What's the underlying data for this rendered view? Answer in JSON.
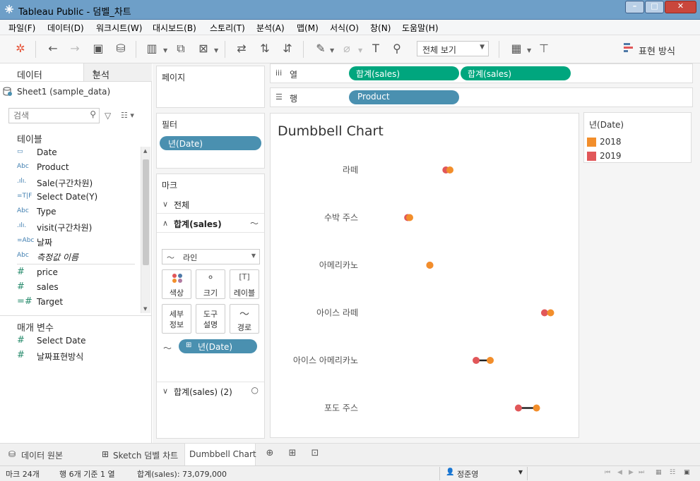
{
  "window": {
    "title": "Tableau Public - 덤벨_차트"
  },
  "menu": [
    "파일(F)",
    "데이터(D)",
    "워크시트(W)",
    "대시보드(B)",
    "스토리(T)",
    "분석(A)",
    "맵(M)",
    "서식(O)",
    "창(N)",
    "도움말(H)"
  ],
  "toolbar": {
    "view_select": "전체 보기",
    "show_me": "표현 방식"
  },
  "data_pane": {
    "tab_data": "데이터",
    "tab_analysis": "분석",
    "datasource": "Sheet1 (sample_data)",
    "search_placeholder": "검색",
    "tables_header": "테이블",
    "fields": [
      {
        "icon": "📅",
        "name": "Date"
      },
      {
        "icon": "Abc",
        "name": "Product"
      },
      {
        "icon": ".ılı.",
        "name": "Sale(구간차원)"
      },
      {
        "icon": "=T|F",
        "name": "Select Date(Y)"
      },
      {
        "icon": "Abc",
        "name": "Type"
      },
      {
        "icon": ".ılı.",
        "name": "visit(구간차원)"
      },
      {
        "icon": "=Abc",
        "name": "날짜"
      },
      {
        "icon": "Abc",
        "name": "측정값 이름"
      },
      {
        "icon": "#",
        "name": "price"
      },
      {
        "icon": "#",
        "name": "sales"
      },
      {
        "icon": "=#",
        "name": "Target"
      }
    ],
    "params_header": "매개 변수",
    "params": [
      {
        "icon": "#",
        "name": "Select Date"
      },
      {
        "icon": "#",
        "name": "날짜표현방식"
      }
    ]
  },
  "cards": {
    "pages": "페이지",
    "filters": "필터",
    "filter_pill": "년(Date)",
    "marks": "마크",
    "marks_all": "전체",
    "marks_sum": "합계(sales)",
    "mark_type": "라인",
    "buttons": {
      "color": "색상",
      "size": "크기",
      "label": "레이블",
      "detail": "세부\n정보",
      "tooltip": "도구\n설명",
      "path": "경로"
    },
    "marks_pill": "년(Date)",
    "marks_sum2": "합계(sales) (2)"
  },
  "shelves": {
    "columns_label": "열",
    "columns_pills": [
      "합계(sales)",
      "합계(sales)"
    ],
    "rows_label": "행",
    "rows_pills": [
      "Product"
    ]
  },
  "viz": {
    "title": "Dumbbell Chart"
  },
  "legend": {
    "title": "년(Date)",
    "items": [
      {
        "label": "2018",
        "color": "#f28e2b"
      },
      {
        "label": "2019",
        "color": "#e15759"
      }
    ]
  },
  "chart_data": {
    "type": "scatter",
    "title": "Dumbbell Chart",
    "categories": [
      "라떼",
      "수박 주스",
      "아메리카노",
      "아이스 라떼",
      "아이스 아메리카노",
      "포도 주스"
    ],
    "series": [
      {
        "name": "2018",
        "color": "#f28e2b",
        "values": [
          0.4,
          0.2,
          0.3,
          0.9,
          0.6,
          0.83
        ]
      },
      {
        "name": "2019",
        "color": "#e15759",
        "values": [
          0.38,
          0.19,
          0.3,
          0.87,
          0.53,
          0.74
        ]
      }
    ],
    "grid": false,
    "legend": "right"
  },
  "sheet_tabs": [
    "데이터 원본",
    "Sketch 덤벨 차트",
    "Dumbbell Chart"
  ],
  "status": {
    "marks": "마크 24개",
    "rows": "행 6개 기준 1 열",
    "sum": "합계(sales): 73,079,000",
    "user": "정준영"
  }
}
